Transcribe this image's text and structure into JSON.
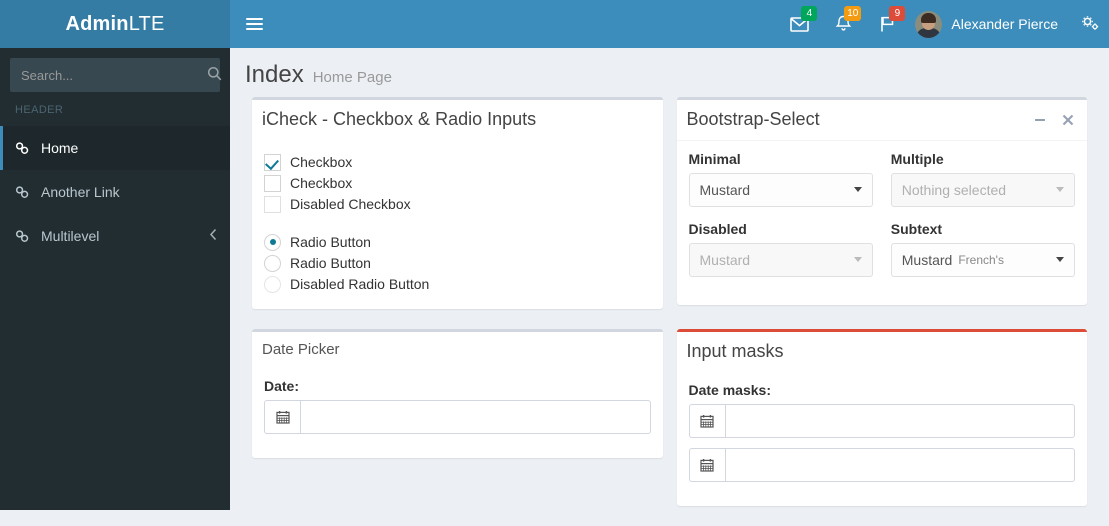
{
  "header": {
    "logo_bold": "Admin",
    "logo_light": "LTE",
    "toggle_icon": "hamburger-icon",
    "messages": {
      "icon": "envelope-icon",
      "count": "4",
      "color": "#00a65a"
    },
    "notifications": {
      "icon": "bell-icon",
      "count": "10",
      "color": "#f39c12"
    },
    "tasks": {
      "icon": "flag-icon",
      "count": "9",
      "color": "#dd4b39"
    },
    "user": {
      "name": "Alexander Pierce",
      "avatar": "user-avatar"
    },
    "control_sidebar_icon": "gears-icon"
  },
  "sidebar": {
    "search": {
      "placeholder": "Search...",
      "value": "",
      "icon": "search-icon"
    },
    "menu_header": "HEADER",
    "items": [
      {
        "label": "Home",
        "icon": "link-icon",
        "active": true
      },
      {
        "label": "Another Link",
        "icon": "link-icon",
        "active": false
      },
      {
        "label": "Multilevel",
        "icon": "link-icon",
        "active": false,
        "arrow": "chevron-left-icon"
      }
    ]
  },
  "page": {
    "title": "Index",
    "subtitle": "Home Page"
  },
  "icheck_box": {
    "title": "iCheck - Checkbox & Radio Inputs",
    "checkboxes": [
      {
        "label": "Checkbox",
        "checked": true,
        "disabled": false
      },
      {
        "label": "Checkbox",
        "checked": false,
        "disabled": false
      },
      {
        "label": "Disabled Checkbox",
        "checked": false,
        "disabled": true
      }
    ],
    "radios": [
      {
        "label": "Radio Button",
        "checked": true,
        "disabled": false
      },
      {
        "label": "Radio Button",
        "checked": false,
        "disabled": false
      },
      {
        "label": "Disabled Radio Button",
        "checked": false,
        "disabled": true
      }
    ]
  },
  "bootstrap_select_box": {
    "title": "Bootstrap-Select",
    "tools": {
      "minimize": "minus-icon",
      "close": "times-icon"
    },
    "fields": {
      "minimal": {
        "label": "Minimal",
        "value": "Mustard",
        "disabled": false
      },
      "multiple": {
        "label": "Multiple",
        "value": "Nothing selected",
        "disabled": true
      },
      "disabled": {
        "label": "Disabled",
        "value": "Mustard",
        "disabled": true
      },
      "subtext": {
        "label": "Subtext",
        "value": "Mustard",
        "subtext": "French's",
        "disabled": false
      }
    }
  },
  "date_picker_box": {
    "title": "Date Picker",
    "field_label": "Date:",
    "input_value": "",
    "addon_icon": "calendar-icon"
  },
  "input_masks_box": {
    "title": "Input masks",
    "field_label": "Date masks:",
    "accent_color": "#dd4b39",
    "inputs": [
      {
        "value": "",
        "addon_icon": "calendar-icon"
      },
      {
        "value": "",
        "addon_icon": "calendar-icon"
      }
    ]
  }
}
